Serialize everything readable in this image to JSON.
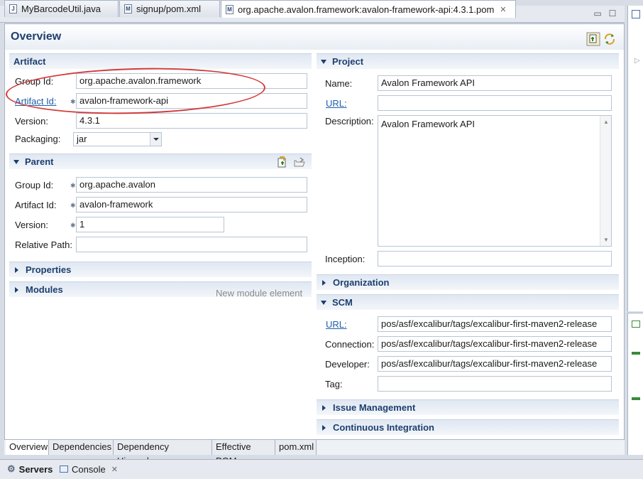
{
  "editor_tabs": [
    {
      "label": "MyBarcodeUtil.java",
      "icon": "java-file-icon"
    },
    {
      "label": "signup/pom.xml",
      "icon": "maven-pom-icon"
    },
    {
      "label": "org.apache.avalon.framework:avalon-framework-api:4.3.1.pom",
      "icon": "maven-pom-icon",
      "active": true
    }
  ],
  "header": {
    "title": "Overview"
  },
  "artifact": {
    "title": "Artifact",
    "group_id_label": "Group Id:",
    "group_id": "org.apache.avalon.framework",
    "artifact_id_label": "Artifact Id:",
    "artifact_id": "avalon-framework-api",
    "version_label": "Version:",
    "version": "4.3.1",
    "packaging_label": "Packaging:",
    "packaging": "jar"
  },
  "parent": {
    "title": "Parent",
    "group_id_label": "Group Id:",
    "group_id": "org.apache.avalon",
    "artifact_id_label": "Artifact Id:",
    "artifact_id": "avalon-framework",
    "version_label": "Version:",
    "version": "1",
    "relative_path_label": "Relative Path:",
    "relative_path": ""
  },
  "properties": {
    "title": "Properties"
  },
  "modules": {
    "title": "Modules",
    "hint": "New module element"
  },
  "project": {
    "title": "Project",
    "name_label": "Name:",
    "name": "Avalon Framework API",
    "url_label": "URL:",
    "url": "",
    "description_label": "Description:",
    "description": "Avalon Framework API",
    "inception_label": "Inception:",
    "inception": ""
  },
  "organization": {
    "title": "Organization"
  },
  "scm": {
    "title": "SCM",
    "url_label": "URL:",
    "url": "pos/asf/excalibur/tags/excalibur-first-maven2-release",
    "connection_label": "Connection:",
    "connection": "pos/asf/excalibur/tags/excalibur-first-maven2-release",
    "developer_label": "Developer:",
    "developer": "pos/asf/excalibur/tags/excalibur-first-maven2-release",
    "tag_label": "Tag:",
    "tag": ""
  },
  "issue_management": {
    "title": "Issue Management"
  },
  "ci": {
    "title": "Continuous Integration"
  },
  "bottom_tabs": [
    "Overview",
    "Dependencies",
    "Dependency Hierarchy",
    "Effective POM",
    "pom.xml"
  ],
  "views": [
    {
      "label": "Servers",
      "icon": "servers-icon"
    },
    {
      "label": "Console",
      "icon": "console-icon"
    }
  ],
  "colors": {
    "accent": "#1d3e6e",
    "annotation": "#d33a3a"
  }
}
